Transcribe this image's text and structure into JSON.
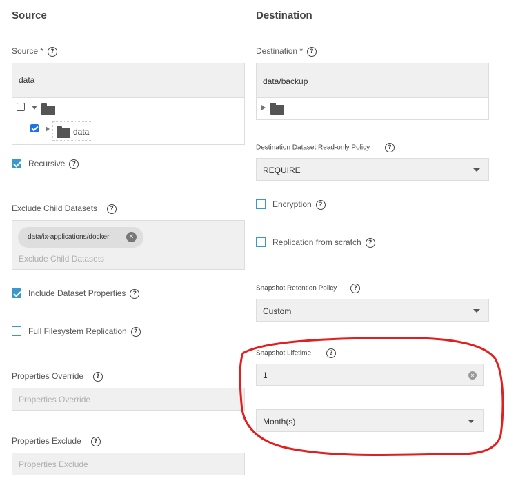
{
  "source": {
    "section_title": "Source",
    "field_label": "Source *",
    "value": "data",
    "tree": {
      "root_checked": false,
      "child_label": "data",
      "child_checked": true
    },
    "recursive": {
      "label": "Recursive",
      "checked": true
    },
    "exclude_child": {
      "label": "Exclude Child Datasets",
      "chip": "data/ix-applications/docker",
      "placeholder": "Exclude Child Datasets"
    },
    "include_props": {
      "label": "Include Dataset Properties",
      "checked": true
    },
    "full_fs": {
      "label": "Full Filesystem Replication",
      "checked": false
    },
    "props_override": {
      "label": "Properties Override",
      "placeholder": "Properties Override"
    },
    "props_exclude": {
      "label": "Properties Exclude",
      "placeholder": "Properties Exclude"
    }
  },
  "destination": {
    "section_title": "Destination",
    "field_label": "Destination *",
    "value": "data/backup",
    "readonly_policy": {
      "label": "Destination Dataset Read-only Policy",
      "value": "REQUIRE"
    },
    "encryption": {
      "label": "Encryption",
      "checked": false
    },
    "from_scratch": {
      "label": "Replication from scratch",
      "checked": false
    },
    "retention": {
      "label": "Snapshot Retention Policy",
      "value": "Custom"
    },
    "lifetime": {
      "label": "Snapshot Lifetime",
      "value": "1",
      "unit": "Month(s)"
    }
  },
  "colors": {
    "accent": "#3a99cc",
    "annotation": "#e02020",
    "field_bg": "#f0f0f0"
  },
  "icons": {
    "help": "question-circle-icon",
    "folder": "folder-icon",
    "dropdown": "caret-down-icon",
    "clear": "clear-circle-icon"
  }
}
